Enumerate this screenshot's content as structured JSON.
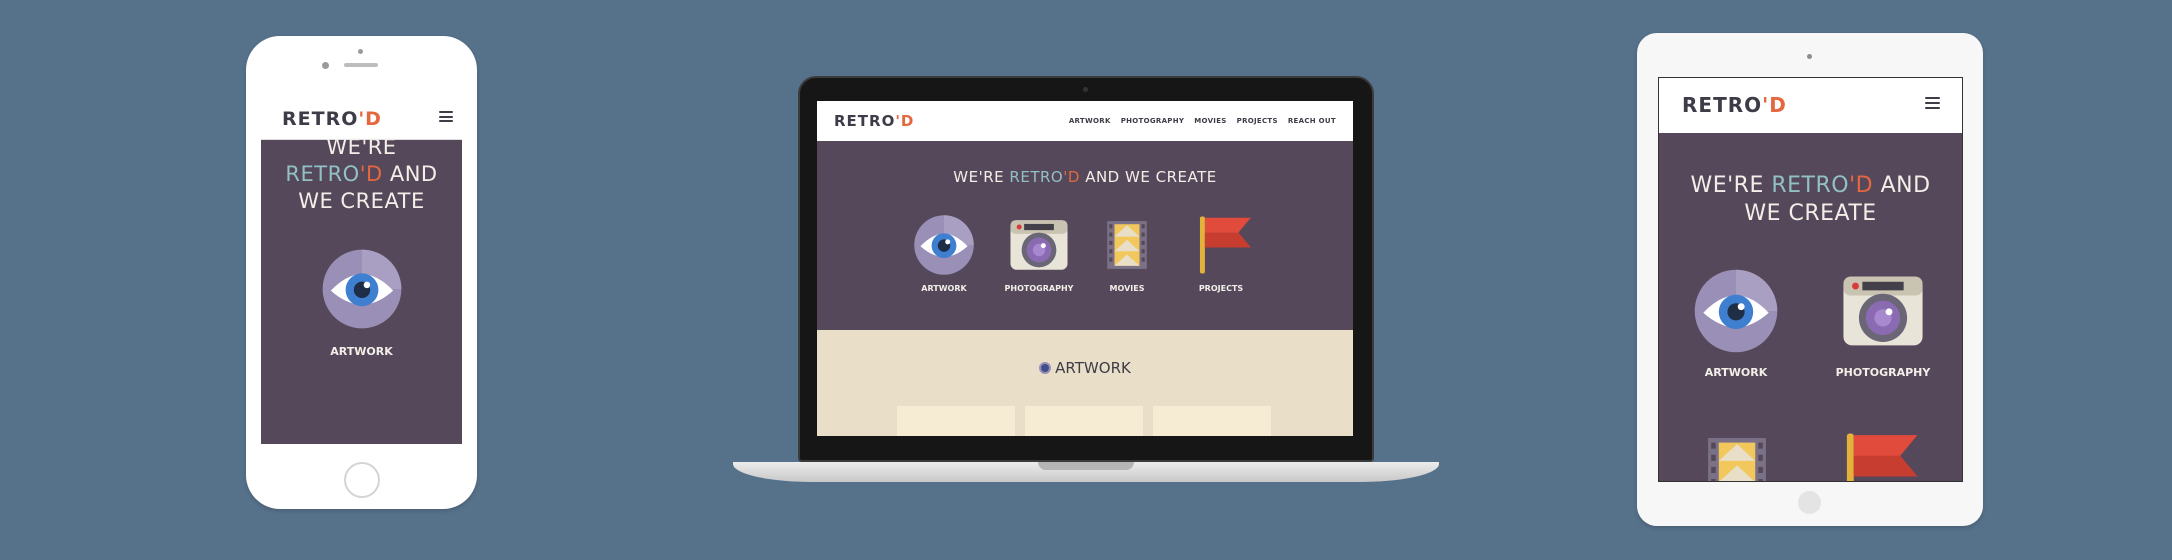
{
  "brand": {
    "name_main": "RETRO",
    "name_accent": "'D"
  },
  "hero": {
    "line_we_are": "WE'RE",
    "line_brand_main": "RETRO",
    "line_brand_accent": "'D",
    "line_and": "AND",
    "line_create": "WE CREATE"
  },
  "nav": {
    "items": [
      {
        "label": "ARTWORK"
      },
      {
        "label": "PHOTOGRAPHY"
      },
      {
        "label": "MOVIES"
      },
      {
        "label": "PROJECTS"
      },
      {
        "label": "REACH OUT"
      }
    ]
  },
  "categories": [
    {
      "label": "ARTWORK",
      "icon": "eye-icon"
    },
    {
      "label": "PHOTOGRAPHY",
      "icon": "camera-icon"
    },
    {
      "label": "MOVIES",
      "icon": "film-icon"
    },
    {
      "label": "PROJECTS",
      "icon": "flag-icon"
    }
  ],
  "section": {
    "title": "ARTWORK"
  },
  "colors": {
    "background": "#56718a",
    "hero": "#54485a",
    "accent": "#e5673f",
    "teal": "#93c0c4",
    "section": "#e9dfc9"
  }
}
